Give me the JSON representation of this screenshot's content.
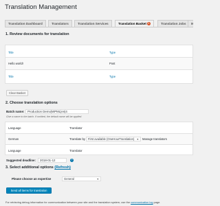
{
  "page_title": "Translation Management",
  "tabs": [
    {
      "label": "Translation Dashboard"
    },
    {
      "label": "Translators"
    },
    {
      "label": "Translation Services"
    },
    {
      "label": "Translation Basket",
      "badge": "1"
    },
    {
      "label": "Translation Jobs"
    },
    {
      "label": "M"
    }
  ],
  "section1": {
    "heading": "1. Review documents for translation",
    "col_title": "Title",
    "col_type": "Type",
    "rows": [
      {
        "title": "Hello world!",
        "type": "Post"
      }
    ],
    "clear_button": "Clear Basket"
  },
  "section2": {
    "heading": "2. Choose translation options",
    "batch_label": "Batch name:",
    "batch_value": "Production Demo|WPML|en|4",
    "batch_hint": "Give a name to the batch. If omitted, the default name will be applied.",
    "col_language": "Language",
    "col_translator": "Translator",
    "language": "German",
    "translate_by_label": "Translate by",
    "translator_select": "First available (OneHourTranslation)",
    "manage_link": "Manage translators",
    "deadline_label": "Suggested deadline:",
    "deadline_value": "2018-01-12",
    "help_icon": "?"
  },
  "section3": {
    "heading": "3. Select additional options",
    "refresh_link": "(Refresh)",
    "expertise_label": "Please choose an expertise",
    "expertise_value": "General",
    "send_button": "Send all items for translation"
  },
  "footer": {
    "text": "For retrieving debug information for communication between your site and the translation system, use the",
    "link": "communication log",
    "suffix": "page."
  }
}
